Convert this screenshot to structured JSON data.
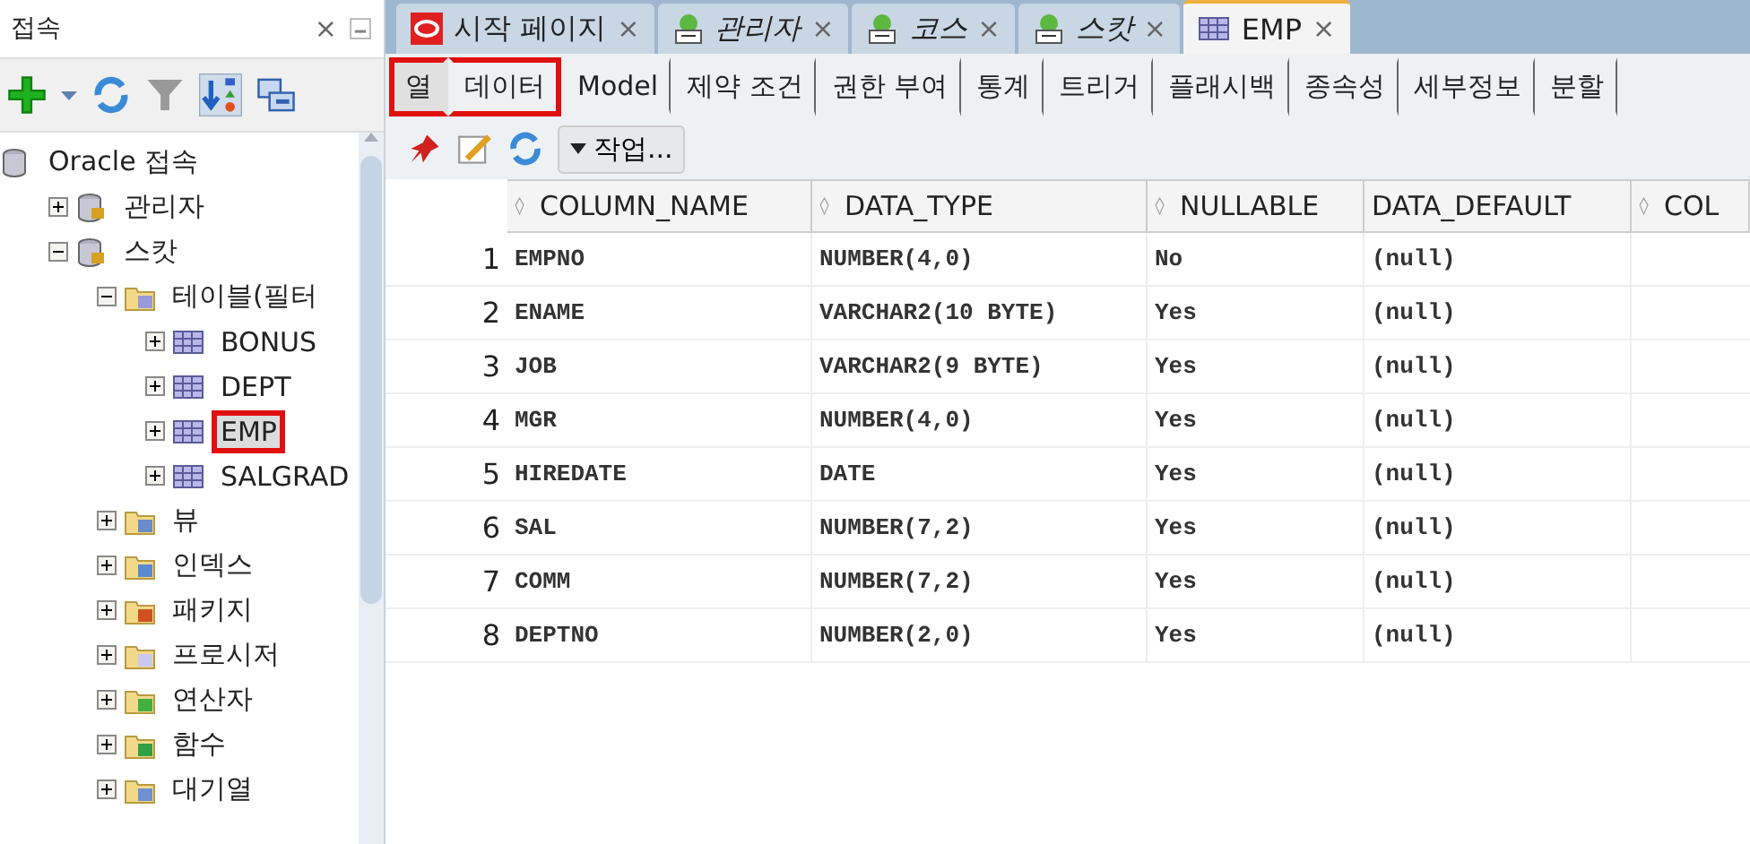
{
  "connections_panel": {
    "title": "접속",
    "close": "×"
  },
  "tree": [
    {
      "label": "Oracle 접속",
      "kind": "root",
      "selected": false,
      "children": [
        {
          "label": "관리자",
          "kind": "connection",
          "expanded": false,
          "selected": false
        },
        {
          "label": "스캇",
          "kind": "connection",
          "expanded": true,
          "selected": false,
          "children": [
            {
              "label": "테이블(필터",
              "kind": "table-folder",
              "expanded": true,
              "selected": false,
              "children": [
                {
                  "label": "BONUS",
                  "kind": "table",
                  "expanded": false,
                  "selected": false,
                  "highlighted": false
                },
                {
                  "label": "DEPT",
                  "kind": "table",
                  "expanded": false,
                  "selected": false,
                  "highlighted": false
                },
                {
                  "label": "EMP",
                  "kind": "table",
                  "expanded": false,
                  "selected": true,
                  "highlighted": true
                },
                {
                  "label": "SALGRAD",
                  "kind": "table",
                  "expanded": false,
                  "selected": false,
                  "highlighted": false
                }
              ]
            },
            {
              "label": "뷰",
              "kind": "view-folder",
              "expanded": false,
              "selected": false
            },
            {
              "label": "인덱스",
              "kind": "index-folder",
              "expanded": false,
              "selected": false
            },
            {
              "label": "패키지",
              "kind": "package-folder",
              "expanded": false,
              "selected": false
            },
            {
              "label": "프로시저",
              "kind": "procedure-folder",
              "expanded": false,
              "selected": false
            },
            {
              "label": "연산자",
              "kind": "operator-folder",
              "expanded": false,
              "selected": false
            },
            {
              "label": "함수",
              "kind": "function-folder",
              "expanded": false,
              "selected": false
            },
            {
              "label": "대기열",
              "kind": "queue-folder",
              "expanded": false,
              "selected": false
            }
          ]
        }
      ]
    }
  ],
  "editor_tabs": [
    {
      "label": "시작 페이지",
      "kind": "start",
      "selected": false,
      "close": "×"
    },
    {
      "label": "관리자",
      "kind": "sql",
      "selected": false,
      "close": "×"
    },
    {
      "label": "코스",
      "kind": "sql",
      "selected": false,
      "close": "×"
    },
    {
      "label": "스캇",
      "kind": "sql",
      "selected": false,
      "close": "×"
    },
    {
      "label": "EMP",
      "kind": "table",
      "selected": true,
      "close": "×"
    }
  ],
  "sub_tabs": [
    {
      "label": "열",
      "selected": true,
      "highlighted": true
    },
    {
      "label": "데이터",
      "selected": false,
      "highlighted": true
    },
    {
      "label": "Model",
      "selected": false,
      "highlighted": false
    },
    {
      "label": "제약 조건",
      "selected": false,
      "highlighted": false
    },
    {
      "label": "권한 부여",
      "selected": false,
      "highlighted": false
    },
    {
      "label": "통계",
      "selected": false,
      "highlighted": false
    },
    {
      "label": "트리거",
      "selected": false,
      "highlighted": false
    },
    {
      "label": "플래시백",
      "selected": false,
      "highlighted": false
    },
    {
      "label": "종속성",
      "selected": false,
      "highlighted": false
    },
    {
      "label": "세부정보",
      "selected": false,
      "highlighted": false
    },
    {
      "label": "분할",
      "selected": false,
      "highlighted": false
    }
  ],
  "toolbar": {
    "actions_menu": "작업..."
  },
  "table": {
    "columns": [
      {
        "label": "COLUMN_NAME",
        "sortable": true
      },
      {
        "label": "DATA_TYPE",
        "sortable": true
      },
      {
        "label": "NULLABLE",
        "sortable": true
      },
      {
        "label": "DATA_DEFAULT",
        "sortable": false
      },
      {
        "label": "COL",
        "sortable": true
      }
    ],
    "rows": [
      {
        "number": "1",
        "cells": [
          "EMPNO",
          "NUMBER(4,0)",
          "No",
          "(null)"
        ]
      },
      {
        "number": "2",
        "cells": [
          "ENAME",
          "VARCHAR2(10 BYTE)",
          "Yes",
          "(null)"
        ]
      },
      {
        "number": "3",
        "cells": [
          "JOB",
          "VARCHAR2(9 BYTE)",
          "Yes",
          "(null)"
        ]
      },
      {
        "number": "4",
        "cells": [
          "MGR",
          "NUMBER(4,0)",
          "Yes",
          "(null)"
        ]
      },
      {
        "number": "5",
        "cells": [
          "HIREDATE",
          "DATE",
          "Yes",
          "(null)"
        ]
      },
      {
        "number": "6",
        "cells": [
          "SAL",
          "NUMBER(7,2)",
          "Yes",
          "(null)"
        ]
      },
      {
        "number": "7",
        "cells": [
          "COMM",
          "NUMBER(7,2)",
          "Yes",
          "(null)"
        ]
      },
      {
        "number": "8",
        "cells": [
          "DEPTNO",
          "NUMBER(2,0)",
          "Yes",
          "(null)"
        ]
      }
    ]
  }
}
